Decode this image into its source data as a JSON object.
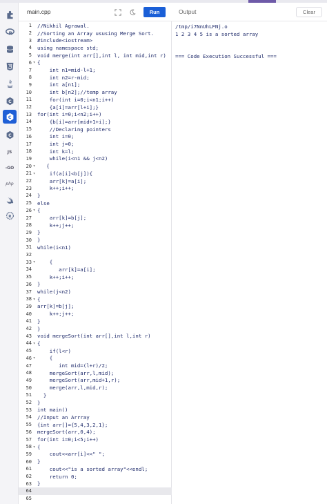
{
  "header": {
    "file_tab": "main.cpp",
    "run_label": "Run",
    "output_label": "Output",
    "clear_label": "Clear"
  },
  "sidebar": {
    "items": [
      {
        "icon": "puzzle-icon"
      },
      {
        "icon": "r-lang-icon"
      },
      {
        "icon": "database-icon"
      },
      {
        "icon": "html5-icon"
      },
      {
        "icon": "java-icon"
      },
      {
        "icon": "c-lang-icon"
      },
      {
        "icon": "cpp-icon",
        "active": true
      },
      {
        "icon": "csharp-icon"
      },
      {
        "icon": "javascript-icon",
        "text": "JS"
      },
      {
        "icon": "go-icon",
        "text": "-GO"
      },
      {
        "icon": "php-icon",
        "text": "php"
      },
      {
        "icon": "swift-icon"
      },
      {
        "icon": "rust-icon"
      }
    ]
  },
  "editor": {
    "lines": [
      {
        "n": "1",
        "fold": "",
        "text": "//Nikhil Agrawal."
      },
      {
        "n": "2",
        "fold": "",
        "text": "//Sorting an Array ususing Merge Sort."
      },
      {
        "n": "3",
        "fold": "",
        "text": "#include<iostream>"
      },
      {
        "n": "4",
        "fold": "",
        "text": "using namespace std;"
      },
      {
        "n": "5",
        "fold": "",
        "text": "void merge(int arr[],int l, int mid,int r)"
      },
      {
        "n": "6",
        "fold": "▾",
        "text": "{"
      },
      {
        "n": "7",
        "fold": "",
        "text": "    int n1=mid-l+1;"
      },
      {
        "n": "8",
        "fold": "",
        "text": "    int n2=r-mid;"
      },
      {
        "n": "9",
        "fold": "",
        "text": "    int a[n1];"
      },
      {
        "n": "10",
        "fold": "",
        "text": "    int b[n2];//temp array"
      },
      {
        "n": "11",
        "fold": "",
        "text": "    for(int i=0;i<n1;i++)"
      },
      {
        "n": "12",
        "fold": "",
        "text": "    {a[i]=arr[l+i];}"
      },
      {
        "n": "13",
        "fold": "",
        "text": "for(int i=0;i<n2;i++)"
      },
      {
        "n": "14",
        "fold": "",
        "text": "    {b[i]=arr[mid+1+i];}"
      },
      {
        "n": "15",
        "fold": "",
        "text": "    //Declaring pointers"
      },
      {
        "n": "16",
        "fold": "",
        "text": "    int i=0;"
      },
      {
        "n": "17",
        "fold": "",
        "text": "    int j=0;"
      },
      {
        "n": "18",
        "fold": "",
        "text": "    int k=l;"
      },
      {
        "n": "19",
        "fold": "",
        "text": "    while(i<n1 && j<n2)"
      },
      {
        "n": "20",
        "fold": "▾",
        "text": "   {"
      },
      {
        "n": "21",
        "fold": "▾",
        "text": "    if(a[i]<b[j]){"
      },
      {
        "n": "22",
        "fold": "",
        "text": "    arr[k]=a[i];"
      },
      {
        "n": "23",
        "fold": "",
        "text": "    k++;i++;"
      },
      {
        "n": "24",
        "fold": "",
        "text": "}"
      },
      {
        "n": "25",
        "fold": "",
        "text": "else"
      },
      {
        "n": "26",
        "fold": "▾",
        "text": "{"
      },
      {
        "n": "27",
        "fold": "",
        "text": "    arr[k]=b[j];"
      },
      {
        "n": "28",
        "fold": "",
        "text": "    k++;j++;"
      },
      {
        "n": "29",
        "fold": "",
        "text": "}"
      },
      {
        "n": "30",
        "fold": "",
        "text": "}"
      },
      {
        "n": "31",
        "fold": "",
        "text": "while(i<n1)"
      },
      {
        "n": "32",
        "fold": "",
        "text": ""
      },
      {
        "n": "33",
        "fold": "▾",
        "text": "    {"
      },
      {
        "n": "34",
        "fold": "",
        "text": "       arr[k]=a[i];"
      },
      {
        "n": "35",
        "fold": "",
        "text": "    k++;i++;"
      },
      {
        "n": "36",
        "fold": "",
        "text": "}"
      },
      {
        "n": "37",
        "fold": "",
        "text": "while(j<n2)"
      },
      {
        "n": "38",
        "fold": "▾",
        "text": "{"
      },
      {
        "n": "39",
        "fold": "",
        "text": "arr[k]=b[j];"
      },
      {
        "n": "40",
        "fold": "",
        "text": "    k++;j++;"
      },
      {
        "n": "41",
        "fold": "",
        "text": "}"
      },
      {
        "n": "42",
        "fold": "",
        "text": "}"
      },
      {
        "n": "43",
        "fold": "",
        "text": "void mergeSort(int arr[],int l,int r)"
      },
      {
        "n": "44",
        "fold": "▾",
        "text": "{"
      },
      {
        "n": "45",
        "fold": "",
        "text": "    if(l<r)"
      },
      {
        "n": "46",
        "fold": "▾",
        "text": "    {"
      },
      {
        "n": "47",
        "fold": "",
        "text": "       int mid=(l+r)/2;"
      },
      {
        "n": "48",
        "fold": "",
        "text": "    mergeSort(arr,l,mid);"
      },
      {
        "n": "49",
        "fold": "",
        "text": "    mergeSort(arr,mid+1,r);"
      },
      {
        "n": "50",
        "fold": "",
        "text": "    merge(arr,l,mid,r);"
      },
      {
        "n": "51",
        "fold": "",
        "text": "  }"
      },
      {
        "n": "52",
        "fold": "",
        "text": "}"
      },
      {
        "n": "53",
        "fold": "",
        "text": "int main()"
      },
      {
        "n": "54",
        "fold": "",
        "text": "//Input an Arrray"
      },
      {
        "n": "55",
        "fold": "",
        "text": "{int arr[]={5,4,3,2,1};"
      },
      {
        "n": "56",
        "fold": "",
        "text": "mergeSort(arr,0,4);"
      },
      {
        "n": "57",
        "fold": "",
        "text": "for(int i=0;i<5;i++)"
      },
      {
        "n": "58",
        "fold": "▾",
        "text": "{"
      },
      {
        "n": "59",
        "fold": "",
        "text": "    cout<<arr[i]<<\" \";"
      },
      {
        "n": "60",
        "fold": "",
        "text": "}"
      },
      {
        "n": "61",
        "fold": "",
        "text": "    cout<<\"is a sorted array\"<<endl;"
      },
      {
        "n": "62",
        "fold": "",
        "text": "    return 0;"
      },
      {
        "n": "63",
        "fold": "",
        "text": "}"
      },
      {
        "n": "64",
        "fold": "",
        "text": "",
        "active": true
      },
      {
        "n": "65",
        "fold": "",
        "text": ""
      }
    ]
  },
  "output": {
    "lines": [
      "/tmp/i7NnUhLFNj.o",
      "1 2 3 4 5 is a sorted array",
      "",
      "",
      "=== Code Execution Successful ==="
    ]
  },
  "colors": {
    "run_button": "#1a5fd7",
    "active_sidebar": "#1f5fd6",
    "code_text": "#1e2a6a"
  }
}
